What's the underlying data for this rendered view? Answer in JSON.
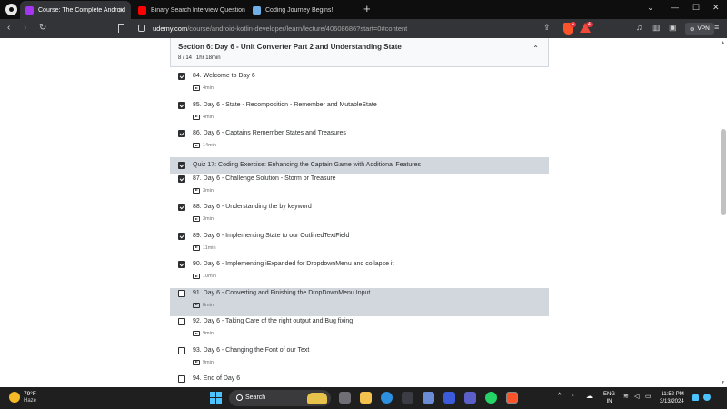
{
  "browser": {
    "tabs": [
      {
        "title": "Course: The Complete Android",
        "active": true,
        "favicon_color": "#a435f0"
      },
      {
        "title": "Binary Search Interview Questions",
        "active": false,
        "favicon_color": "#ff0000"
      },
      {
        "title": "Coding Journey Begins!",
        "active": false,
        "favicon_color": "#6fb0e8"
      }
    ],
    "url_host": "udemy.com",
    "url_path": "/course/android-kotlin-developer/learn/lecture/40608686?start=0#content",
    "shield_badge": "4",
    "rewards_badge": "4",
    "vpn_label": "VPN"
  },
  "section": {
    "title": "Section 6: Day 6 - Unit Converter Part 2 and Understanding State",
    "meta": "8 / 14 | 1hr 18min"
  },
  "lectures": [
    {
      "title": "84. Welcome to Day 6",
      "duration": "4min",
      "done": true,
      "type": "video",
      "highlight": false
    },
    {
      "title": "85. Day 6 - State - Recomposition - Remember and MutableState",
      "duration": "4min",
      "done": true,
      "type": "video",
      "highlight": false
    },
    {
      "title": "86. Day 6 - Captains Remember States and Treasures",
      "duration": "14min",
      "done": true,
      "type": "video",
      "highlight": false
    },
    {
      "title": "Quiz 17: Coding Exercise: Enhancing the Captain Game with Additional Features",
      "duration": "",
      "done": true,
      "type": "quiz",
      "highlight": true
    },
    {
      "title": "87. Day 6 - Challenge Solution - Storm or Treasure",
      "duration": "3min",
      "done": true,
      "type": "video",
      "highlight": false
    },
    {
      "title": "88. Day 6 - Understanding the by keyword",
      "duration": "3min",
      "done": true,
      "type": "video",
      "highlight": false
    },
    {
      "title": "89. Day 6 - Implementing State to our OutlinedTextField",
      "duration": "11min",
      "done": true,
      "type": "video",
      "highlight": false
    },
    {
      "title": "90. Day 6 - Implementing iExpanded for DropdownMenu and collapse it",
      "duration": "10min",
      "done": true,
      "type": "video",
      "highlight": false
    },
    {
      "title": "91. Day 6 - Converting and Finishing the DropDownMenu Input",
      "duration": "8min",
      "done": false,
      "type": "video",
      "highlight": true
    },
    {
      "title": "92. Day 6 - Taking Care of the right output and Bug fixing",
      "duration": "9min",
      "done": false,
      "type": "video",
      "highlight": false
    },
    {
      "title": "93. Day 6 - Changing the Font of our Text",
      "duration": "9min",
      "done": false,
      "type": "video",
      "highlight": false
    },
    {
      "title": "94. End of Day 6",
      "duration": "",
      "done": false,
      "type": "video",
      "highlight": false
    }
  ],
  "taskbar": {
    "temperature": "79°F",
    "condition": "Haze",
    "search_label": "Search",
    "lang_top": "ENG",
    "lang_bottom": "IN",
    "time": "11:52 PM",
    "date": "3/13/2024"
  }
}
